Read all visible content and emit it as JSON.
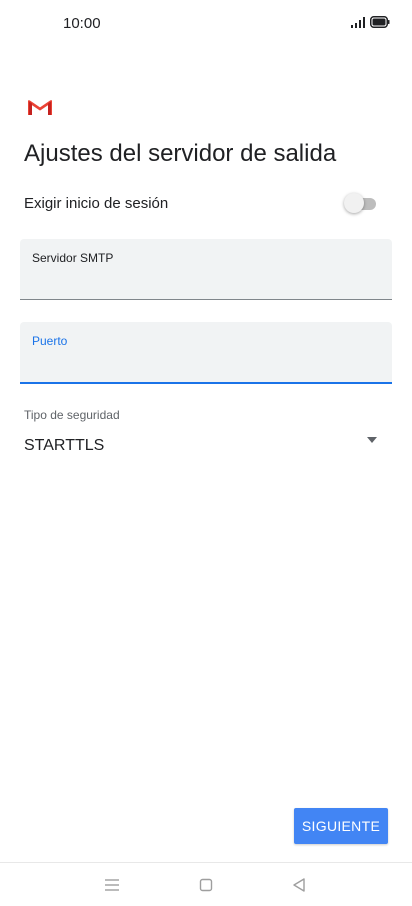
{
  "status_bar": {
    "time": "10:00"
  },
  "header": {
    "title": "Ajustes del servidor de salida"
  },
  "login_toggle": {
    "label": "Exigir inicio de sesión",
    "checked": false
  },
  "smtp_field": {
    "label": "Servidor SMTP",
    "value": ""
  },
  "port_field": {
    "label": "Puerto",
    "value": ""
  },
  "security": {
    "caption": "Tipo de seguridad",
    "selected": "STARTTLS"
  },
  "actions": {
    "next_label": "SIGUIENTE"
  },
  "colors": {
    "accent": "#1a73e8",
    "button": "#4285f4",
    "gmail_red": "#ea4335",
    "field_bg": "#f1f3f4"
  },
  "icons": {
    "gmail": "gmail-logo-icon",
    "signal": "signal-icon",
    "battery": "battery-icon",
    "dropdown": "dropdown-arrow-icon",
    "nav_menu": "menu-icon",
    "nav_home": "home-icon",
    "nav_back": "back-icon"
  }
}
